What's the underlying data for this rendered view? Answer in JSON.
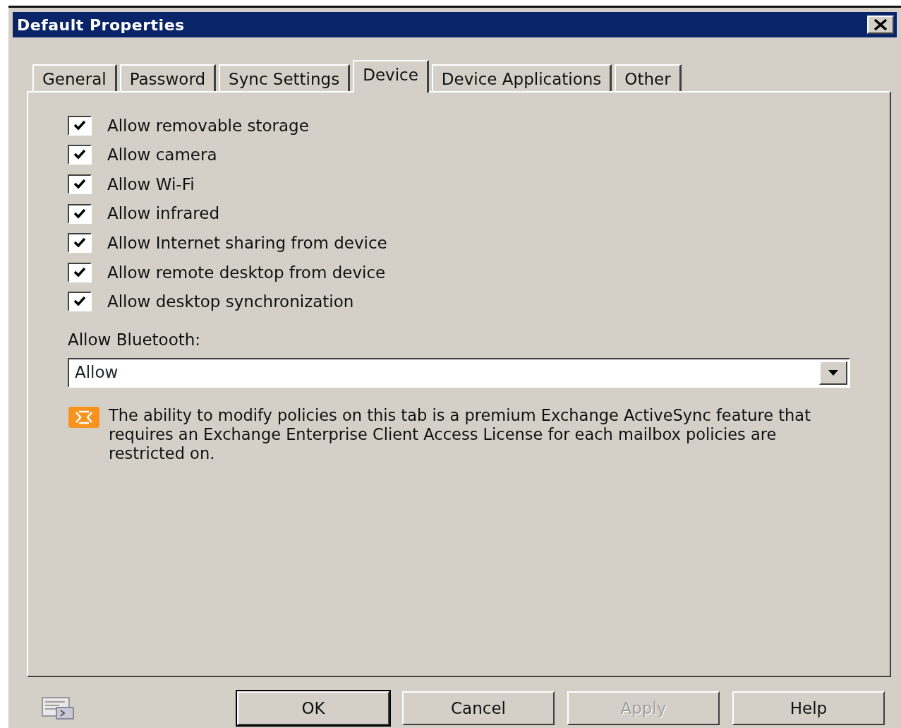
{
  "window": {
    "title": "Default Properties"
  },
  "tabs": [
    {
      "label": "General",
      "selected": false
    },
    {
      "label": "Password",
      "selected": false
    },
    {
      "label": "Sync Settings",
      "selected": false
    },
    {
      "label": "Device",
      "selected": true
    },
    {
      "label": "Device Applications",
      "selected": false
    },
    {
      "label": "Other",
      "selected": false
    }
  ],
  "checkboxes": [
    {
      "label": "Allow removable storage",
      "checked": true
    },
    {
      "label": "Allow camera",
      "checked": true
    },
    {
      "label": "Allow Wi-Fi",
      "checked": true
    },
    {
      "label": "Allow infrared",
      "checked": true
    },
    {
      "label": "Allow Internet sharing from device",
      "checked": true
    },
    {
      "label": "Allow remote desktop from device",
      "checked": true
    },
    {
      "label": "Allow desktop synchronization",
      "checked": true
    }
  ],
  "bluetooth": {
    "label": "Allow Bluetooth:",
    "value": "Allow"
  },
  "note": "The ability to modify policies on this tab is a premium Exchange ActiveSync feature that requires an Exchange Enterprise Client Access License for each mailbox policies are restricted on.",
  "buttons": [
    {
      "label": "OK",
      "default": true,
      "disabled": false
    },
    {
      "label": "Cancel",
      "default": false,
      "disabled": false
    },
    {
      "label": "Apply",
      "default": false,
      "disabled": true
    },
    {
      "label": "Help",
      "default": false,
      "disabled": false
    }
  ]
}
